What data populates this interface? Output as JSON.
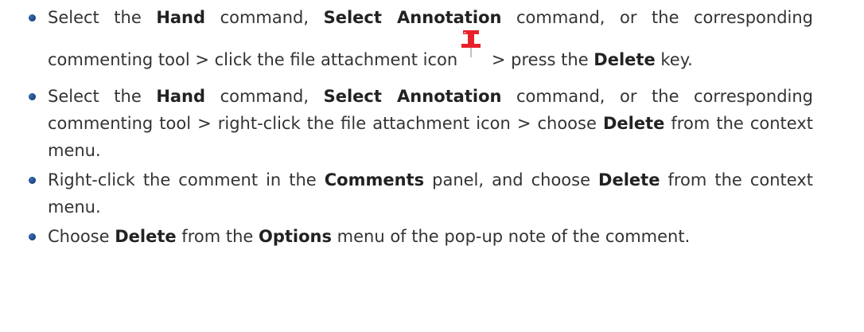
{
  "items": [
    {
      "seg": [
        "Select the ",
        "Hand",
        " command, ",
        "Select Annotation",
        " command, or the corresponding commenting tool > click the file attachment icon",
        " > press the ",
        "Delete",
        " key."
      ]
    },
    {
      "seg": [
        "Select the ",
        "Hand",
        " command, ",
        "Select Annotation",
        " command, or the corresponding commenting tool > right-click the file attachment icon > choose ",
        "Delete",
        " from the context menu."
      ]
    },
    {
      "seg": [
        "Right-click the comment in the ",
        "Comments",
        " panel, and choose ",
        "Delete",
        " from the context menu."
      ]
    },
    {
      "seg": [
        "Choose ",
        "Delete",
        " from the ",
        "Options",
        " menu of the pop-up note of the comment."
      ]
    }
  ],
  "icons": {
    "file_attachment": "pushpin-icon",
    "pin_color": "#e8202a",
    "bullet_color": "#1f4a8a"
  }
}
